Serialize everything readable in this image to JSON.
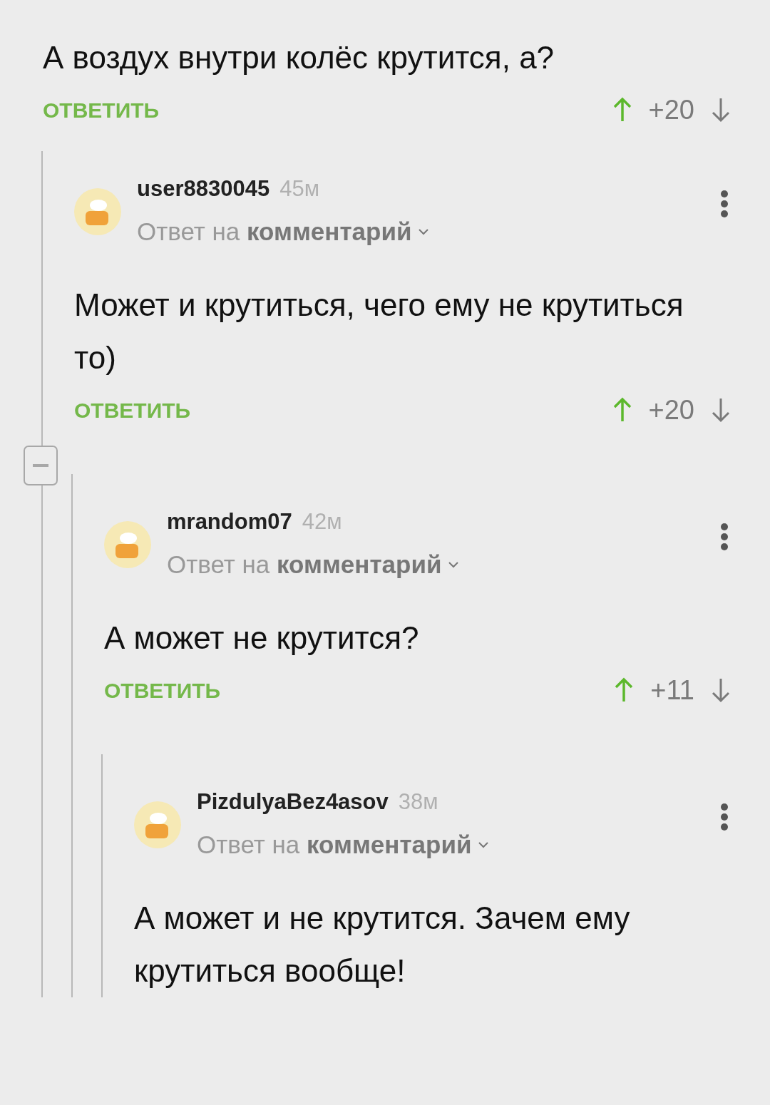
{
  "comment": {
    "text": "А воздух внутри колёс крутится, а?",
    "reply_label": "ОТВЕТИТЬ",
    "score": "+20",
    "upvoted": true,
    "children": [
      {
        "username": "user8830045",
        "time": "45м",
        "reply_to": "Ответ на **комментарий**",
        "text": "Может и крутиться, чего ему не крутиться то)",
        "reply_label": "ОТВЕТИТЬ",
        "score": "+20",
        "upvoted": true,
        "children": [
          {
            "username": "mrandom07",
            "time": "42м",
            "reply_to": "Ответ на **комментарий**",
            "text": "А может не крутится?",
            "reply_label": "ОТВЕТИТЬ",
            "score": "+11",
            "upvoted": true,
            "children": [
              {
                "username": "PizdulyaBez4asov",
                "time": "38м",
                "reply_to": "Ответ на **комментарий**",
                "text": "А может и не крутится. Зачем ему крутиться вообще!"
              }
            ]
          }
        ]
      }
    ]
  }
}
